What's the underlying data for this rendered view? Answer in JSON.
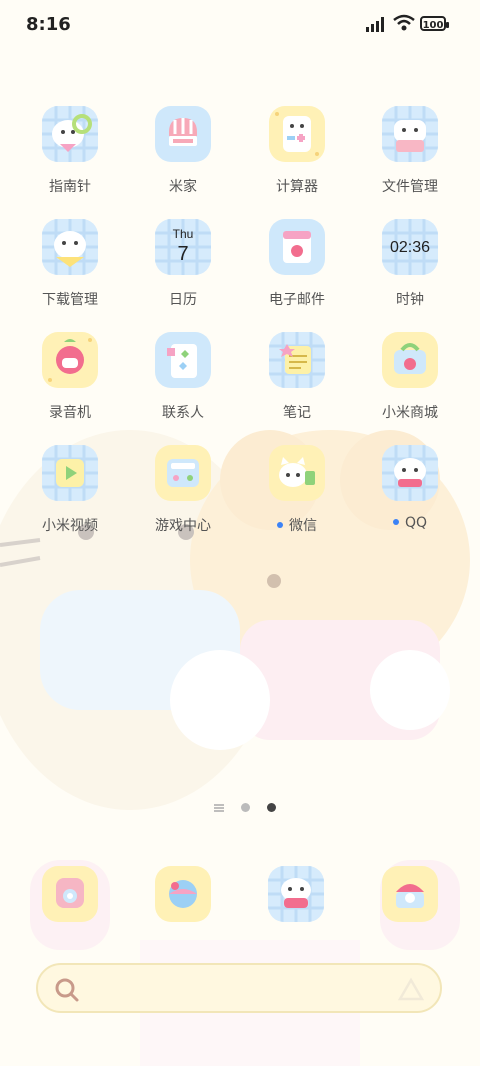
{
  "status_bar": {
    "time": "8:16",
    "battery": "100"
  },
  "apps": [
    {
      "label": "指南针",
      "icon": "compass-cat-icon"
    },
    {
      "label": "米家",
      "icon": "mijia-icon"
    },
    {
      "label": "计算器",
      "icon": "calculator-icon"
    },
    {
      "label": "文件管理",
      "icon": "file-manager-icon"
    },
    {
      "label": "下载管理",
      "icon": "download-manager-icon"
    },
    {
      "label": "日历",
      "icon": "calendar-icon",
      "weekday": "Thu",
      "day": "7"
    },
    {
      "label": "电子邮件",
      "icon": "email-icon"
    },
    {
      "label": "时钟",
      "icon": "clock-icon",
      "clock": "02:36"
    },
    {
      "label": "录音机",
      "icon": "recorder-icon"
    },
    {
      "label": "联系人",
      "icon": "contacts-icon"
    },
    {
      "label": "笔记",
      "icon": "notes-icon"
    },
    {
      "label": "小米商城",
      "icon": "mi-store-icon"
    },
    {
      "label": "小米视频",
      "icon": "mi-video-icon"
    },
    {
      "label": "游戏中心",
      "icon": "game-center-icon"
    },
    {
      "label": "微信",
      "icon": "wechat-icon",
      "new_dot": true
    },
    {
      "label": "QQ",
      "icon": "qq-icon",
      "new_dot": true
    }
  ],
  "dock": [
    {
      "icon": "phone-icon"
    },
    {
      "icon": "browser-icon"
    },
    {
      "icon": "messages-icon"
    },
    {
      "icon": "camera-icon"
    }
  ],
  "page_indicator": {
    "pages": 2,
    "current": 2
  },
  "colors": {
    "blue_tile": "#cfe7fb",
    "yellow_tile": "#fff2b8",
    "pink": "#f6b6c4",
    "accent_dot": "#3b82f6"
  }
}
